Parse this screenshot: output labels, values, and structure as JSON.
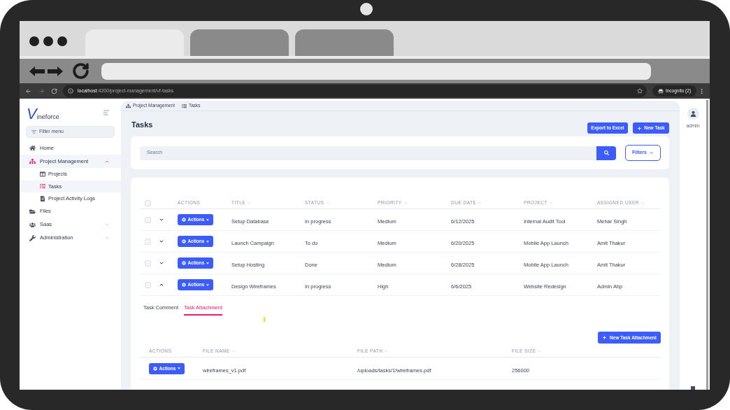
{
  "browser_mockup": {
    "tabs": [
      {
        "selected": true
      },
      {
        "selected": false
      },
      {
        "selected": false
      }
    ]
  },
  "browser": {
    "url": {
      "host": "localhost",
      "path": ":4200/project-management/vf-tasks"
    },
    "incognito": "Incognito (2)"
  },
  "sidebar": {
    "logo": {
      "mark": "V",
      "name": "ineforce"
    },
    "filter": {
      "placeholder": "Filter menu"
    },
    "items": [
      {
        "label": "Home",
        "selected": false
      },
      {
        "label": "Project Management",
        "selected": true,
        "expanded": true,
        "children": [
          {
            "label": "Projects",
            "selected": false
          },
          {
            "label": "Tasks",
            "selected": true
          },
          {
            "label": "Project Activity Logs",
            "selected": false
          }
        ]
      },
      {
        "label": "Files",
        "selected": false
      },
      {
        "label": "Saas",
        "selected": false,
        "expanded": false
      },
      {
        "label": "Administration",
        "selected": false,
        "expanded": false
      }
    ]
  },
  "breadcrumb": [
    {
      "label": "Project Management"
    },
    {
      "label": "Tasks"
    }
  ],
  "page": {
    "title": "Tasks",
    "buttons": [
      {
        "label": "Export to Excel",
        "kind": "plain"
      },
      {
        "label": "New Task",
        "kind": "add"
      }
    ]
  },
  "search": {
    "placeholder": "Search",
    "filters_label": "Filters"
  },
  "tasks_table": {
    "select_all_checked": false,
    "columns": [
      {
        "label": "ACTIONS",
        "sortable": false
      },
      {
        "label": "TITLE",
        "sortable": true
      },
      {
        "label": "STATUS",
        "sortable": true
      },
      {
        "label": "PRIORITY",
        "sortable": true
      },
      {
        "label": "DUE DATE",
        "sortable": true
      },
      {
        "label": "PROJECT",
        "sortable": true
      },
      {
        "label": "ASSIGNED USER",
        "sortable": true
      }
    ],
    "rows": [
      {
        "checked": false,
        "expanded": false,
        "cells": [
          "Actions",
          "Setup Database",
          "In progress",
          "Medium",
          "6/12/2025",
          "Internal Audit Tool",
          "Mehar Singh"
        ]
      },
      {
        "checked": false,
        "expanded": false,
        "cells": [
          "Actions",
          "Launch Campaign",
          "To do",
          "Medium",
          "6/20/2025",
          "Mobile App Launch",
          "Amit Thakur"
        ]
      },
      {
        "checked": false,
        "expanded": false,
        "cells": [
          "Actions",
          "Setup Hosting",
          "Done",
          "Medium",
          "6/28/2025",
          "Mobile App Launch",
          "Amit Thakur"
        ]
      },
      {
        "checked": false,
        "expanded": true,
        "cells": [
          "Actions",
          "Design Wireframes",
          "In progress",
          "High",
          "6/6/2025",
          "Website Redesign",
          "Admin Abp"
        ],
        "detail": {
          "tabs": [
            {
              "label": "Task Comment",
              "selected": false
            },
            {
              "label": "Task Attachment",
              "selected": true
            }
          ],
          "new_button": "New Task Attachment",
          "columns": [
            {
              "label": "ACTIONS",
              "sortable": false
            },
            {
              "label": "FILE NAME",
              "sortable": true
            },
            {
              "label": "FILE PATH",
              "sortable": true
            },
            {
              "label": "FILE SIZE",
              "sortable": true
            }
          ],
          "rows": [
            {
              "cells": [
                "Actions",
                "wireframes_v1.pdf",
                "/uploads/tasks/1/wireframes.pdf",
                "256000"
              ]
            }
          ]
        }
      }
    ]
  },
  "user_panel": {
    "name": "admin"
  }
}
